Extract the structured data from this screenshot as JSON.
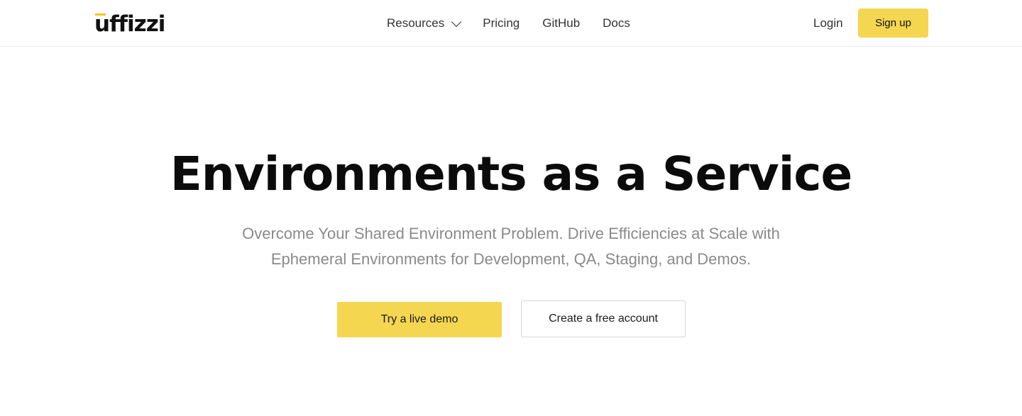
{
  "header": {
    "logo_text": "uffizzi",
    "nav": [
      {
        "label": "Resources",
        "icon": "chevron-down-icon"
      },
      {
        "label": "Pricing"
      },
      {
        "label": "GitHub"
      },
      {
        "label": "Docs"
      }
    ],
    "login_label": "Login",
    "signup_label": "Sign up"
  },
  "hero": {
    "title": "Environments as a Service",
    "subtitle_line1": "Overcome Your Shared Environment Problem. Drive Efficiencies at Scale with",
    "subtitle_line2": "Ephemeral Environments for Development, QA, Staging, and Demos.",
    "demo_button": "Try a live demo",
    "account_button": "Create a free account"
  },
  "colors": {
    "accent": "#f5d650",
    "text": "#111111",
    "muted": "#8a8a8a",
    "border": "#e9e9e9"
  }
}
